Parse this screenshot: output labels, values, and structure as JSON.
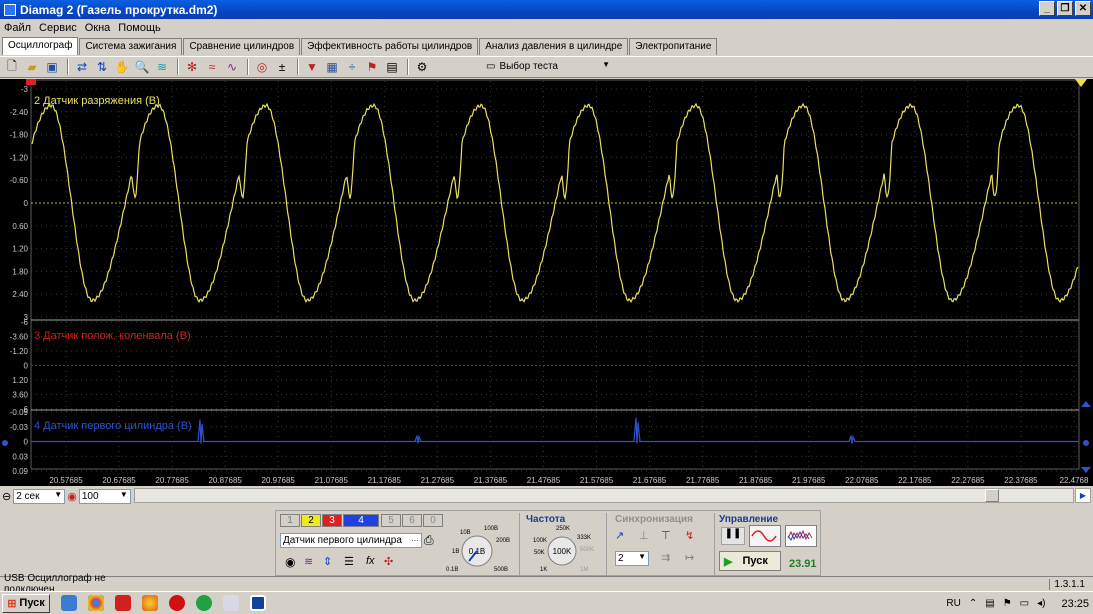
{
  "window": {
    "title": "Diamag 2 (Газель прокрутка.dm2)",
    "controls": [
      "_",
      "❐",
      "✕"
    ]
  },
  "menu": [
    "Файл",
    "Сервис",
    "Окна",
    "Помощь"
  ],
  "tabs": [
    "Осциллограф",
    "Система зажигания",
    "Сравнение цилиндров",
    "Эффективность работы цилиндров",
    "Анализ давления в цилиндре",
    "Электропитание"
  ],
  "toolbar": {
    "test_select": "Выбор теста"
  },
  "channels": [
    {
      "label": "2 Датчик разряжения (В)",
      "color": "#e8e060",
      "ticks": [
        "-3",
        "-2.40",
        "-1.80",
        "-1.20",
        "-0.60",
        "0",
        "0.60",
        "1.20",
        "1.80",
        "2.40",
        "3"
      ]
    },
    {
      "label": "3 Датчик полож. коленвала (В)",
      "color": "#cc2020",
      "ticks": [
        "-6",
        "-3.60",
        "-1.20",
        "0",
        "1.20",
        "3.60",
        "6"
      ]
    },
    {
      "label": "4 Датчик первого цилиндра (В)",
      "color": "#3050d0",
      "ticks": [
        "-0.09",
        "-0.03",
        "0",
        "0.03",
        "0.09"
      ]
    }
  ],
  "time_axis": [
    "20.57685",
    "20.67685",
    "20.77685",
    "20.87685",
    "20.97685",
    "21.07685",
    "21.17685",
    "21.27685",
    "21.37685",
    "21.47685",
    "21.57685",
    "21.67685",
    "21.77685",
    "21.87685",
    "21.97685",
    "22.07685",
    "22.17685",
    "22.27685",
    "22.37685",
    "22.4768"
  ],
  "bottom": {
    "timebase": "2 сек",
    "zoom": "100"
  },
  "control_panel": {
    "channel_buttons": [
      "1",
      "2",
      "3",
      "4",
      "5",
      "6",
      "0"
    ],
    "sensor": "Датчик первого цилиндра",
    "voltage_knob": {
      "value": "0.1В",
      "labels": [
        "10В",
        "100В",
        "200В",
        "500В",
        "1В",
        "0.1В"
      ]
    },
    "frequency": {
      "title": "Частота",
      "value": "100K",
      "labels": [
        "250K",
        "100K",
        "333K",
        "50K",
        "500K",
        "1K",
        "1M"
      ]
    },
    "sync": {
      "title": "Синхронизация",
      "channel": "2"
    },
    "management": {
      "title": "Управление",
      "start": "Пуск",
      "fps": "23.91"
    }
  },
  "status": {
    "text": "USB Осциллограф не подключен",
    "version": "1.3.1.1"
  },
  "taskbar": {
    "start": "Пуск",
    "lang": "RU",
    "clock": "23:25"
  }
}
